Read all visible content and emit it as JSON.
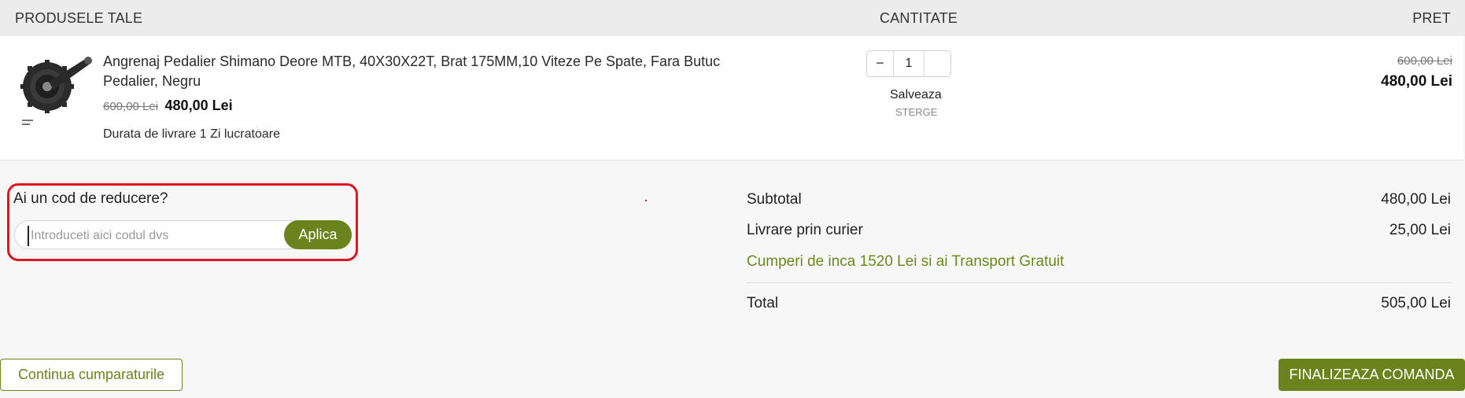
{
  "header": {
    "products": "PRODUSELE TALE",
    "quantity": "CANTITATE",
    "price": "PRET"
  },
  "item": {
    "image_icon": "crankset-image",
    "title": "Angrenaj Pedalier Shimano Deore MTB, 40X30X22T, Brat 175MM,10 Viteze Pe Spate, Fara Butuc Pedalier, Negru",
    "old_price": "600,00 Lei",
    "new_price": "480,00 Lei",
    "delivery": "Durata de livrare 1 Zi lucratoare",
    "quantity": "1",
    "minus_label": "−",
    "plus_label": "",
    "save_label": "Salveaza",
    "delete_label": "STERGE",
    "line_old_total": "600,00 Lei",
    "line_total": "480,00 Lei"
  },
  "coupon": {
    "title": "Ai un cod de reducere?",
    "placeholder": "Introduceti aici codul dvs",
    "apply_label": "Aplica"
  },
  "summary": {
    "subtotal_label": "Subtotal",
    "subtotal_value": "480,00 Lei",
    "shipping_label": "Livrare prin curier",
    "shipping_value": "25,00 Lei",
    "free_shipping_note": "Cumperi de inca 1520 Lei si ai Transport Gratuit",
    "total_label": "Total",
    "total_value": "505,00 Lei"
  },
  "actions": {
    "continue_label": "Continua cumparaturile",
    "checkout_label": "FINALIZEAZA COMANDA"
  },
  "colors": {
    "accent": "#6b831c",
    "highlight": "#e0151f",
    "free_shipping": "#6b8a1c"
  }
}
